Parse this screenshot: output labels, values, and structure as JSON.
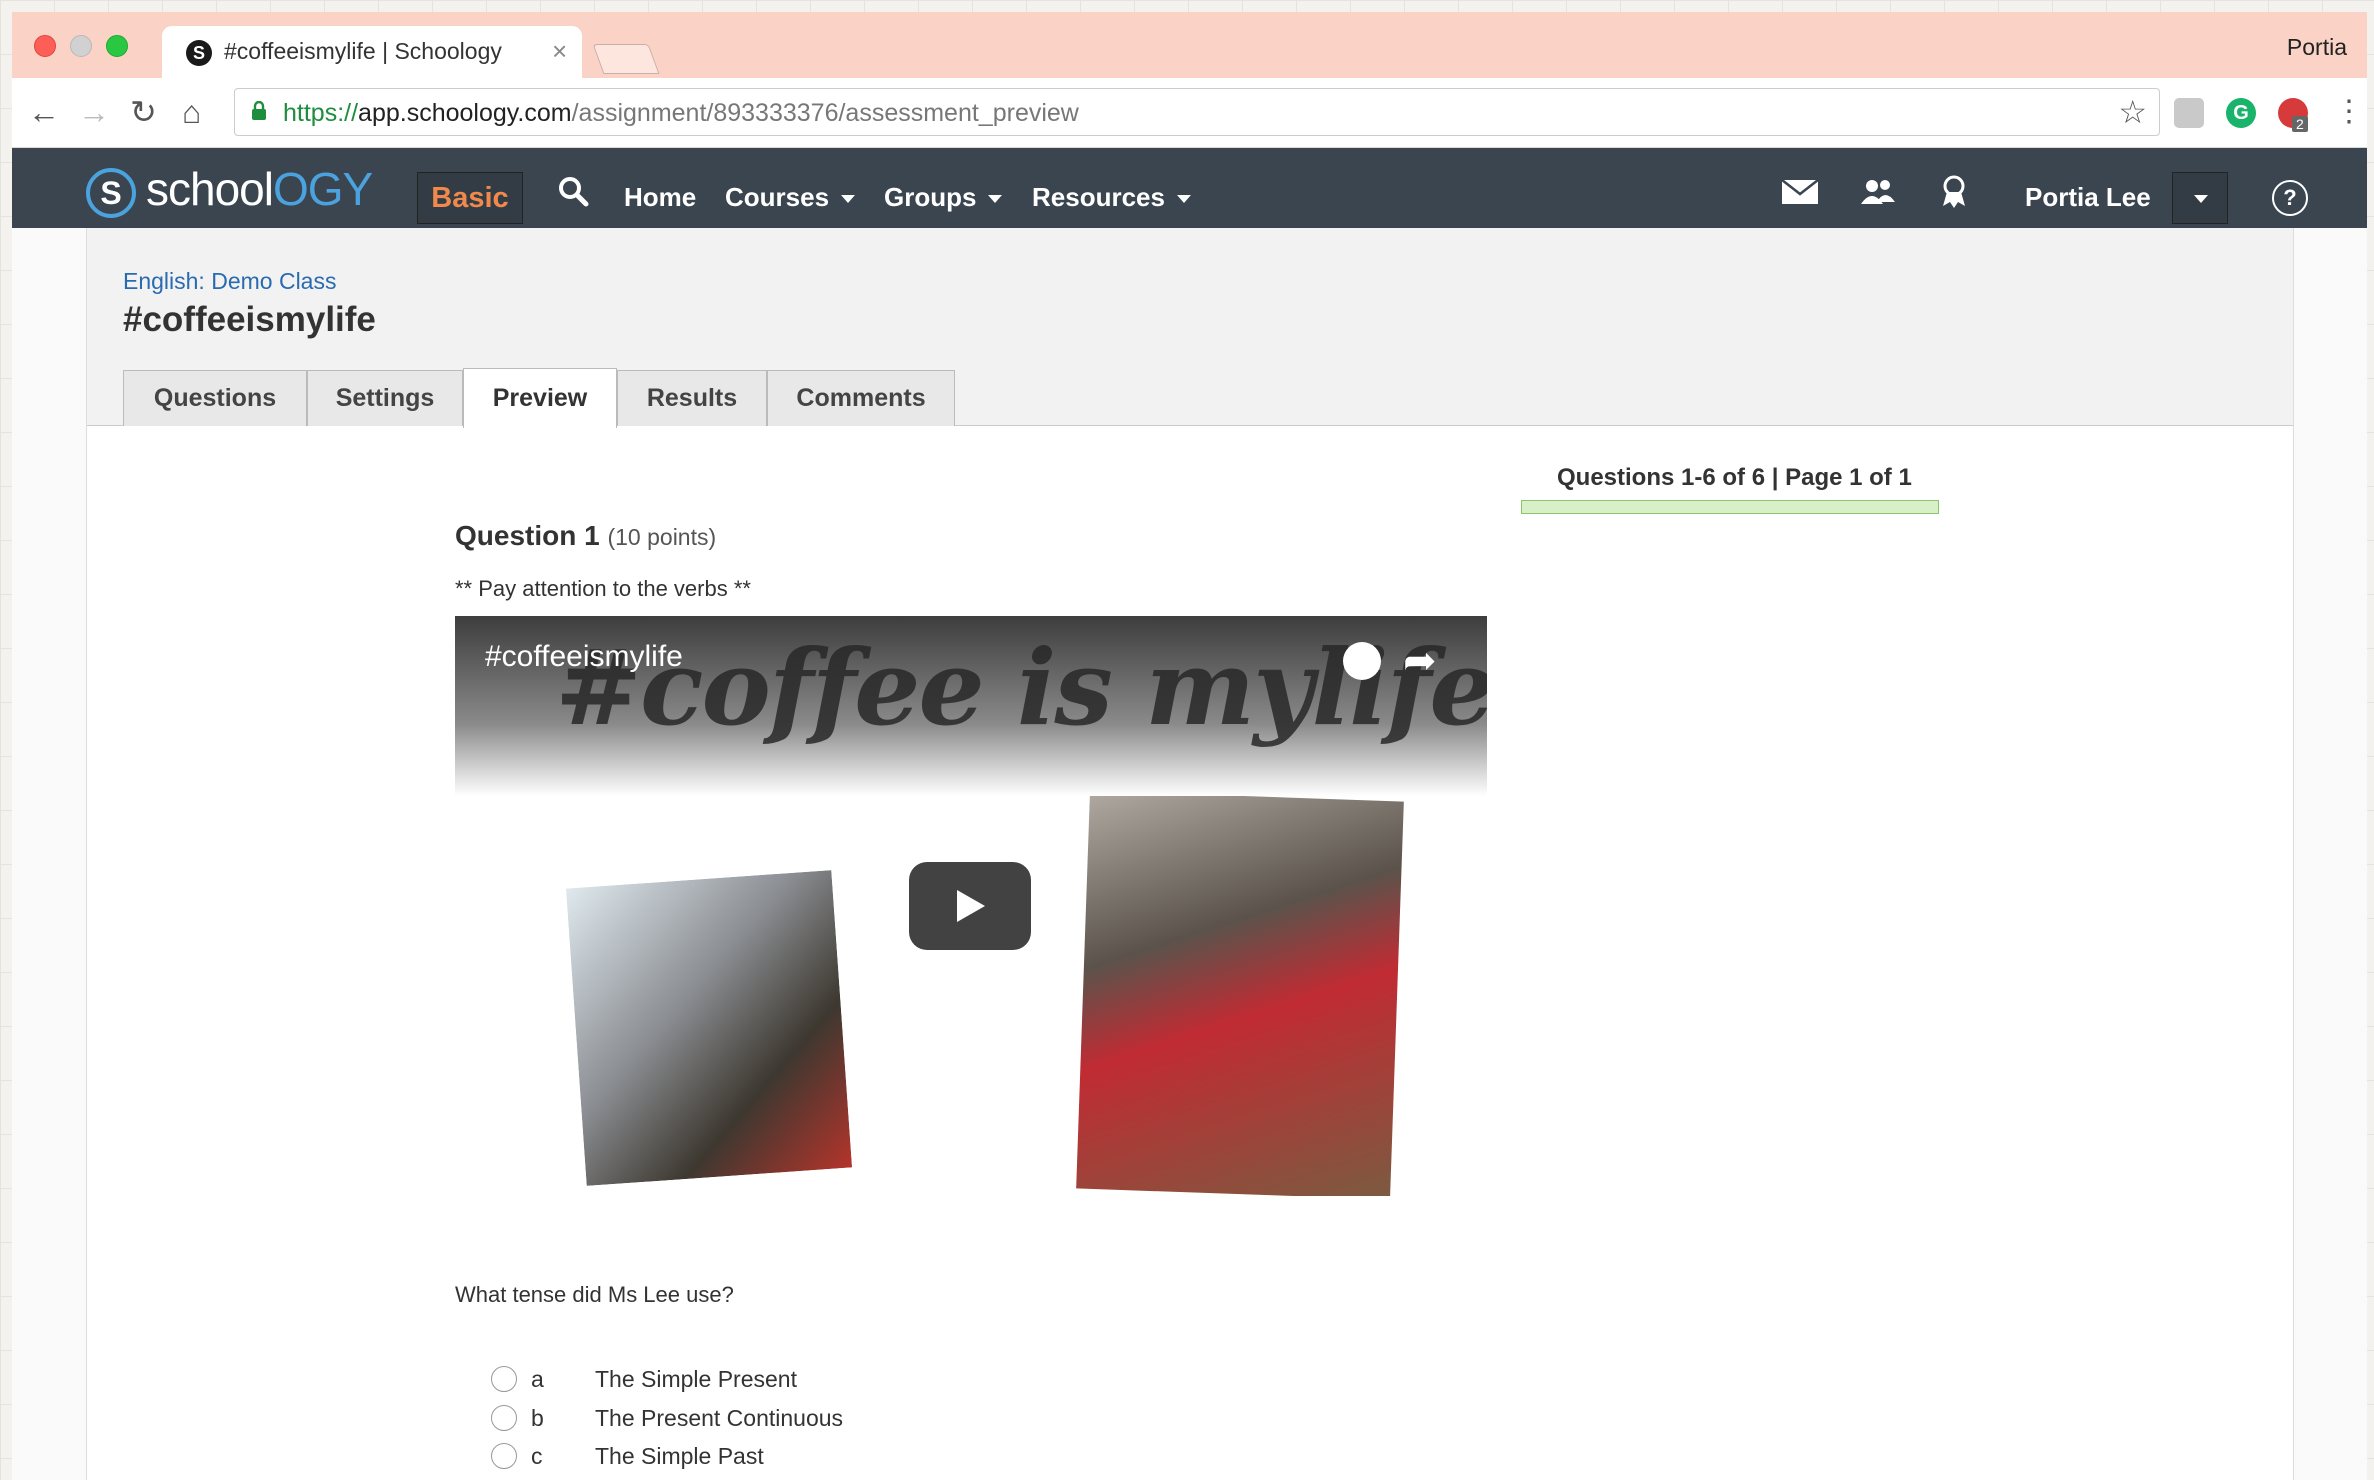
{
  "browser": {
    "tab_title": "#coffeeismylife | Schoology",
    "tab_favicon": "S",
    "tab_close": "×",
    "profile_name": "Portia",
    "url_scheme": "https://",
    "url_host": "app.schoology.com",
    "url_path": "/assignment/893333376/assessment_preview",
    "icons": {
      "back": "←",
      "forward": "→",
      "reload": "↻",
      "home": "⌂",
      "star": "☆",
      "menu": "⋮"
    },
    "extensions": {
      "grammarly_label": "G",
      "badge_count": "2"
    }
  },
  "header": {
    "logo_mark": "S",
    "logo_text_a": "school",
    "logo_text_b": "OGY",
    "basic_label": "Basic",
    "nav": {
      "home": "Home",
      "courses": "Courses",
      "groups": "Groups",
      "resources": "Resources"
    },
    "user_name": "Portia Lee",
    "help_label": "?"
  },
  "course": {
    "breadcrumb": "English: Demo Class",
    "title": "#coffeeismylife",
    "tabs": {
      "questions": "Questions",
      "settings": "Settings",
      "preview": "Preview",
      "results": "Results",
      "comments": "Comments"
    },
    "active_tab": "Preview"
  },
  "assessment": {
    "pager": "Questions 1-6 of 6 | Page 1 of 1",
    "progress_fraction": 1.0,
    "question_title": "Question 1",
    "question_points": "(10 points)",
    "instruction": "** Pay attention to the verbs **",
    "video": {
      "title": "#coffeeismylife",
      "handwriting": "#coffee is mylife"
    },
    "prompt": "What tense did Ms Lee use?",
    "choices": [
      {
        "letter": "a",
        "text": "The Simple Present"
      },
      {
        "letter": "b",
        "text": "The Present Continuous"
      },
      {
        "letter": "c",
        "text": "The Simple Past"
      }
    ]
  },
  "colors": {
    "tabstrip": "#fbd3c6",
    "header": "#3b4550",
    "basic_accent": "#f0894b",
    "brand_blue": "#4aa3df",
    "link": "#2a6bb0"
  }
}
